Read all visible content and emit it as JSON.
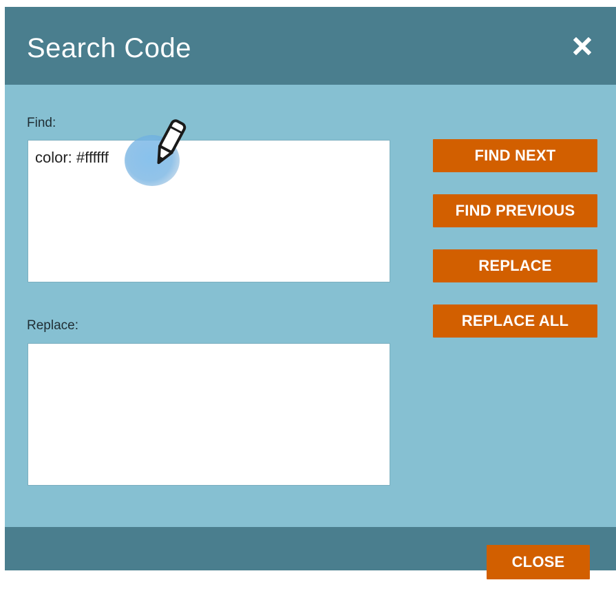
{
  "dialog": {
    "title": "Search Code",
    "close_icon": "close-x-icon"
  },
  "find": {
    "label": "Find:",
    "value": "color: #ffffff"
  },
  "replace": {
    "label": "Replace:",
    "value": ""
  },
  "buttons": {
    "find_next": "FIND NEXT",
    "find_previous": "FIND PREVIOUS",
    "replace": "REPLACE",
    "replace_all": "REPLACE ALL",
    "close": "CLOSE"
  },
  "cursor": {
    "icon": "pencil-cursor-icon"
  },
  "colors": {
    "header": "#4a7e8e",
    "body": "#86c0d2",
    "button": "#d25f00",
    "field": "#ffffff"
  }
}
